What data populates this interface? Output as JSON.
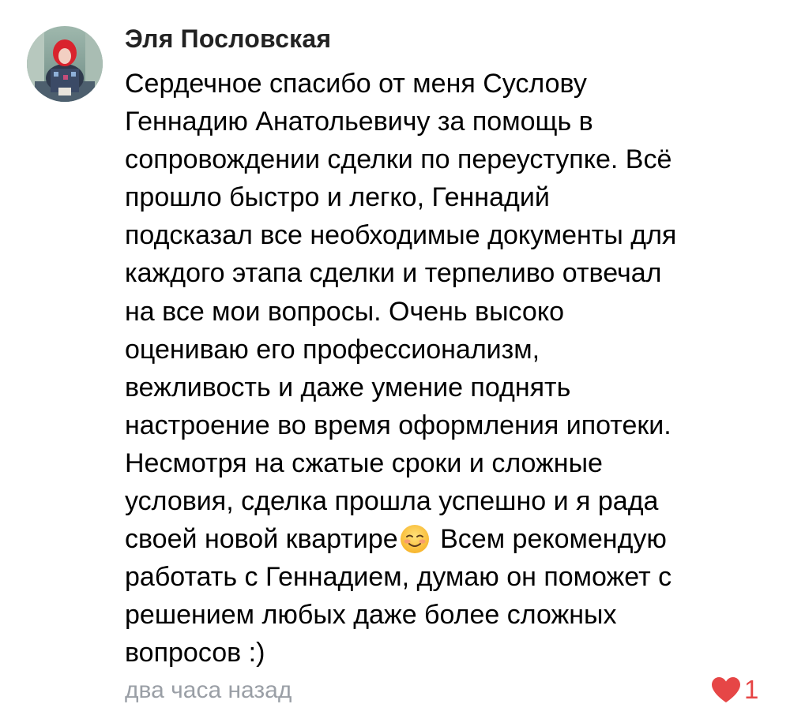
{
  "comment": {
    "author": "Эля Пословская",
    "text_lines": [
      "Сердечное спасибо от меня Суслову",
      "Геннадию Анатольевичу за помощь в",
      "сопровождении сделки по переуступке. Всё",
      "прошло быстро и легко, Геннадий",
      "подсказал все необходимые документы для",
      "каждого этапа сделки и терпеливо отвечал",
      "на все мои вопросы. Очень высоко",
      "оцениваю его профессионализм,",
      "вежливость и даже умение поднять",
      "настроение во время оформления ипотеки.",
      "Несмотря на сжатые сроки и сложные",
      "условия, сделка прошла успешно и я рада"
    ],
    "emoji_line": {
      "before": "своей новой квартире",
      "emoji": "smiling-face-emoji",
      "after": "Всем рекомендую"
    },
    "text_lines_after": [
      "работать с Геннадием, думаю он поможет с",
      "решением любых даже более сложных",
      "вопросов :)"
    ],
    "timestamp": "два часа назад",
    "likes": {
      "icon": "heart-icon",
      "count": "1",
      "color": "#e64646"
    }
  },
  "colors": {
    "author": "#222222",
    "text": "#000000",
    "timestamp": "#9a9fa6",
    "like": "#e64646"
  }
}
